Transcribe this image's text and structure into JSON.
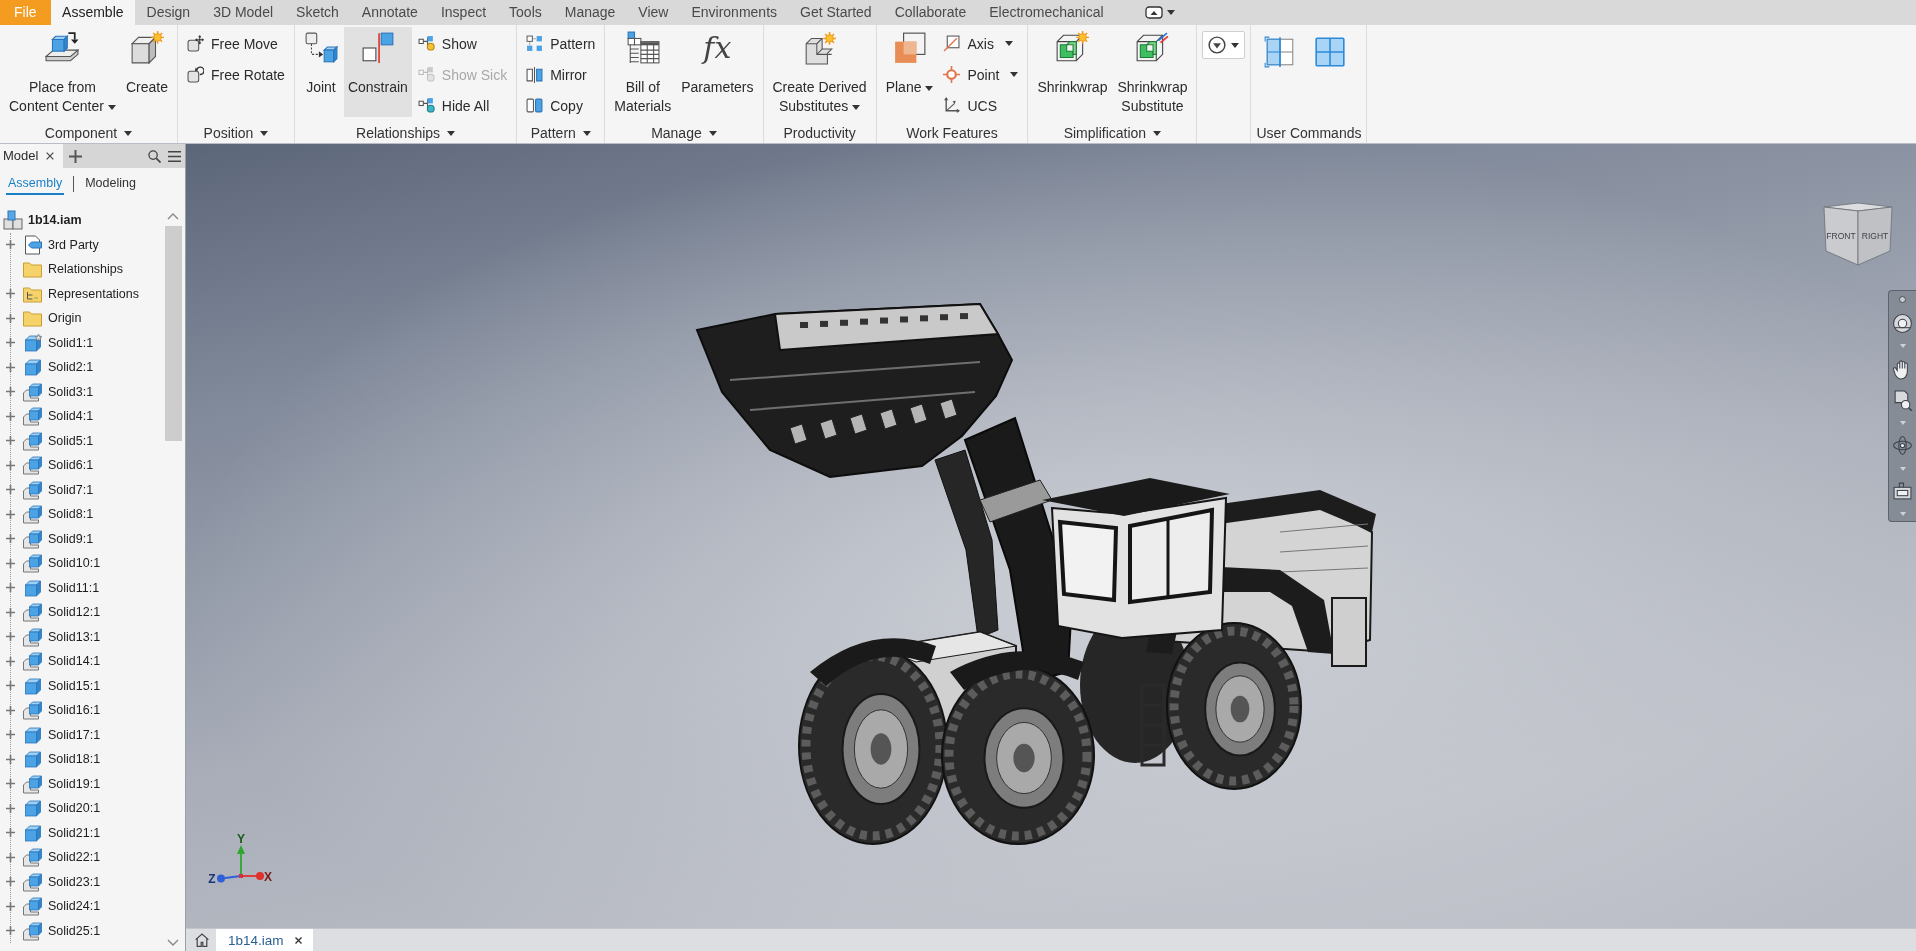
{
  "ribbon_tabs": [
    {
      "label": "File",
      "kind": "file",
      "selected": false
    },
    {
      "label": "Assemble",
      "kind": "tab",
      "selected": true
    },
    {
      "label": "Design",
      "kind": "tab",
      "selected": false
    },
    {
      "label": "3D Model",
      "kind": "tab",
      "selected": false
    },
    {
      "label": "Sketch",
      "kind": "tab",
      "selected": false
    },
    {
      "label": "Annotate",
      "kind": "tab",
      "selected": false
    },
    {
      "label": "Inspect",
      "kind": "tab",
      "selected": false
    },
    {
      "label": "Tools",
      "kind": "tab",
      "selected": false
    },
    {
      "label": "Manage",
      "kind": "tab",
      "selected": false
    },
    {
      "label": "View",
      "kind": "tab",
      "selected": false
    },
    {
      "label": "Environments",
      "kind": "tab",
      "selected": false
    },
    {
      "label": "Get Started",
      "kind": "tab",
      "selected": false
    },
    {
      "label": "Collaborate",
      "kind": "tab",
      "selected": false
    },
    {
      "label": "Electromechanical",
      "kind": "tab",
      "selected": false
    }
  ],
  "ribbon_panels": [
    {
      "label": "Component",
      "menu": true,
      "tools": [
        {
          "kind": "large",
          "label": "Place from\nContent Center",
          "dropdown": true,
          "disabled": false,
          "highlighted": false
        },
        {
          "kind": "large",
          "label": "Create",
          "dropdown": false,
          "disabled": false,
          "highlighted": false
        }
      ]
    },
    {
      "label": "Position",
      "menu": true,
      "tools": [
        {
          "kind": "small",
          "label": "Free Move",
          "dropdown": false,
          "disabled": false,
          "highlighted": false
        },
        {
          "kind": "small",
          "label": "Free Rotate",
          "dropdown": false,
          "disabled": false,
          "highlighted": false
        }
      ]
    },
    {
      "label": "Relationships",
      "menu": true,
      "tools": [
        {
          "kind": "large",
          "label": "Joint",
          "dropdown": false,
          "disabled": false,
          "highlighted": false
        },
        {
          "kind": "large",
          "label": "Constrain",
          "dropdown": false,
          "disabled": false,
          "highlighted": true
        },
        {
          "kind": "small",
          "label": "Show",
          "dropdown": false,
          "disabled": false,
          "highlighted": false
        },
        {
          "kind": "small",
          "label": "Show Sick",
          "dropdown": false,
          "disabled": true,
          "highlighted": false
        },
        {
          "kind": "small",
          "label": "Hide All",
          "dropdown": false,
          "disabled": false,
          "highlighted": false
        }
      ]
    },
    {
      "label": "Pattern",
      "menu": true,
      "tools": [
        {
          "kind": "small",
          "label": "Pattern",
          "dropdown": false,
          "disabled": false,
          "highlighted": false
        },
        {
          "kind": "small",
          "label": "Mirror",
          "dropdown": false,
          "disabled": false,
          "highlighted": false
        },
        {
          "kind": "small",
          "label": "Copy",
          "dropdown": false,
          "disabled": false,
          "highlighted": false
        }
      ]
    },
    {
      "label": "Manage",
      "menu": true,
      "tools": [
        {
          "kind": "large",
          "label": "Bill of\nMaterials",
          "dropdown": false,
          "disabled": false,
          "highlighted": false
        },
        {
          "kind": "large",
          "label": "Parameters",
          "glyph": "fx",
          "dropdown": false,
          "disabled": false,
          "highlighted": false
        }
      ]
    },
    {
      "label": "Productivity",
      "menu": false,
      "tools": [
        {
          "kind": "large",
          "label": "Create Derived\nSubstitutes",
          "dropdown": true,
          "disabled": false,
          "highlighted": false
        }
      ]
    },
    {
      "label": "Work Features",
      "menu": false,
      "tools": [
        {
          "kind": "large",
          "label": "Plane",
          "dropdown": true,
          "disabled": false,
          "highlighted": false
        },
        {
          "kind": "small",
          "label": "Axis",
          "dropdown": true,
          "disabled": false,
          "highlighted": false
        },
        {
          "kind": "small",
          "label": "Point",
          "dropdown": true,
          "disabled": false,
          "highlighted": false
        },
        {
          "kind": "small",
          "label": "UCS",
          "dropdown": false,
          "disabled": false,
          "highlighted": false
        }
      ]
    },
    {
      "label": "Simplification",
      "menu": true,
      "tools": [
        {
          "kind": "large",
          "label": "Shrinkwrap",
          "dropdown": false,
          "disabled": false,
          "highlighted": false
        },
        {
          "kind": "large",
          "label": "Shrinkwrap\nSubstitute",
          "dropdown": false,
          "disabled": false,
          "highlighted": false
        }
      ]
    },
    {
      "tools": [
        {
          "kind": "menu",
          "dropdown": true,
          "disabled": false,
          "highlighted": false
        }
      ]
    },
    {
      "label": "User Commands",
      "menu": false,
      "tools": [
        {
          "kind": "icon",
          "dropdown": false,
          "disabled": false,
          "highlighted": false
        },
        {
          "kind": "icon",
          "dropdown": false,
          "disabled": false,
          "highlighted": false
        }
      ]
    }
  ],
  "browser": {
    "panel_tab": {
      "label": "Model",
      "closable": true
    },
    "view_tabs": [
      {
        "label": "Assembly",
        "selected": true
      },
      {
        "label": "Modeling",
        "selected": false
      }
    ],
    "tree": {
      "label": "1b14.iam",
      "children": [
        {
          "label": "3rd Party",
          "kind": "thirdparty",
          "expandable": true
        },
        {
          "label": "Relationships",
          "kind": "folder",
          "expandable": false
        },
        {
          "label": "Representations",
          "kind": "representations",
          "expandable": true
        },
        {
          "label": "Origin",
          "kind": "folder",
          "expandable": true
        },
        {
          "label": "Solid1:1",
          "kind": "linked",
          "expandable": true
        },
        {
          "label": "Solid2:1",
          "kind": "solid",
          "expandable": true
        },
        {
          "label": "Solid3:1",
          "kind": "stacked",
          "expandable": true
        },
        {
          "label": "Solid4:1",
          "kind": "stacked",
          "expandable": true
        },
        {
          "label": "Solid5:1",
          "kind": "stacked",
          "expandable": true
        },
        {
          "label": "Solid6:1",
          "kind": "stacked",
          "expandable": true
        },
        {
          "label": "Solid7:1",
          "kind": "stacked",
          "expandable": true
        },
        {
          "label": "Solid8:1",
          "kind": "stacked",
          "expandable": true
        },
        {
          "label": "Solid9:1",
          "kind": "stacked",
          "expandable": true
        },
        {
          "label": "Solid10:1",
          "kind": "stacked",
          "expandable": true
        },
        {
          "label": "Solid11:1",
          "kind": "solid",
          "expandable": true
        },
        {
          "label": "Solid12:1",
          "kind": "stacked",
          "expandable": true
        },
        {
          "label": "Solid13:1",
          "kind": "stacked",
          "expandable": true
        },
        {
          "label": "Solid14:1",
          "kind": "stacked",
          "expandable": true
        },
        {
          "label": "Solid15:1",
          "kind": "solid",
          "expandable": true
        },
        {
          "label": "Solid16:1",
          "kind": "stacked",
          "expandable": true
        },
        {
          "label": "Solid17:1",
          "kind": "solid",
          "expandable": true
        },
        {
          "label": "Solid18:1",
          "kind": "solid",
          "expandable": true
        },
        {
          "label": "Solid19:1",
          "kind": "stacked",
          "expandable": true
        },
        {
          "label": "Solid20:1",
          "kind": "solid",
          "expandable": true
        },
        {
          "label": "Solid21:1",
          "kind": "solid",
          "expandable": true
        },
        {
          "label": "Solid22:1",
          "kind": "stacked",
          "expandable": true
        },
        {
          "label": "Solid23:1",
          "kind": "stacked",
          "expandable": true
        },
        {
          "label": "Solid24:1",
          "kind": "stacked",
          "expandable": true
        },
        {
          "label": "Solid25:1",
          "kind": "stacked",
          "expandable": true
        }
      ]
    }
  },
  "viewport": {
    "view_cube": {
      "faces": [
        "FRONT",
        "RIGHT"
      ]
    },
    "axes": [
      {
        "label": "Y",
        "color": "#2da82d"
      },
      {
        "label": "Z",
        "color": "#2f5fd8"
      },
      {
        "label": "X",
        "color": "#e0312b"
      }
    ]
  },
  "document_tabs": [
    {
      "label": "1b14.iam",
      "selected": true,
      "closable": true
    }
  ]
}
